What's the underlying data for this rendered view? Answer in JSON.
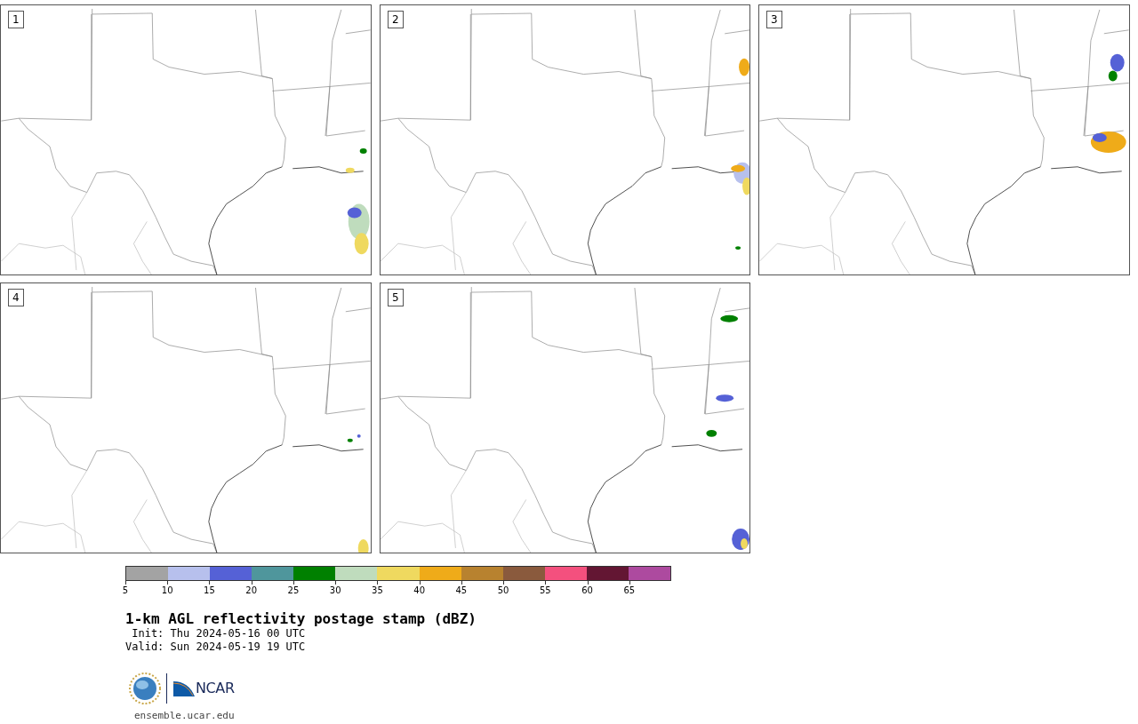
{
  "panels": [
    {
      "label": "1"
    },
    {
      "label": "2"
    },
    {
      "label": "3"
    },
    {
      "label": "4"
    },
    {
      "label": "5"
    }
  ],
  "colorbar": {
    "bins": [
      {
        "label": "5",
        "color": "#a3a3a3"
      },
      {
        "label": "10",
        "color": "#b7c0ed"
      },
      {
        "label": "15",
        "color": "#5561d6"
      },
      {
        "label": "20",
        "color": "#4f969c"
      },
      {
        "label": "25",
        "color": "#008000"
      },
      {
        "label": "30",
        "color": "#bfdcbd"
      },
      {
        "label": "35",
        "color": "#efd95f"
      },
      {
        "label": "40",
        "color": "#efab19"
      },
      {
        "label": "45",
        "color": "#b8822f"
      },
      {
        "label": "50",
        "color": "#8a5a3d"
      },
      {
        "label": "55",
        "color": "#f4507e"
      },
      {
        "label": "60",
        "color": "#631633"
      },
      {
        "label": "65",
        "color": "#ad4a9f"
      }
    ]
  },
  "title": "1-km AGL reflectivity postage stamp (dBZ)",
  "init": " Init: Thu 2024-05-16 00 UTC",
  "valid": "Valid: Sun 2024-05-19 19 UTC",
  "logo": {
    "text": "NCAR"
  },
  "url": "ensemble.ucar.edu"
}
